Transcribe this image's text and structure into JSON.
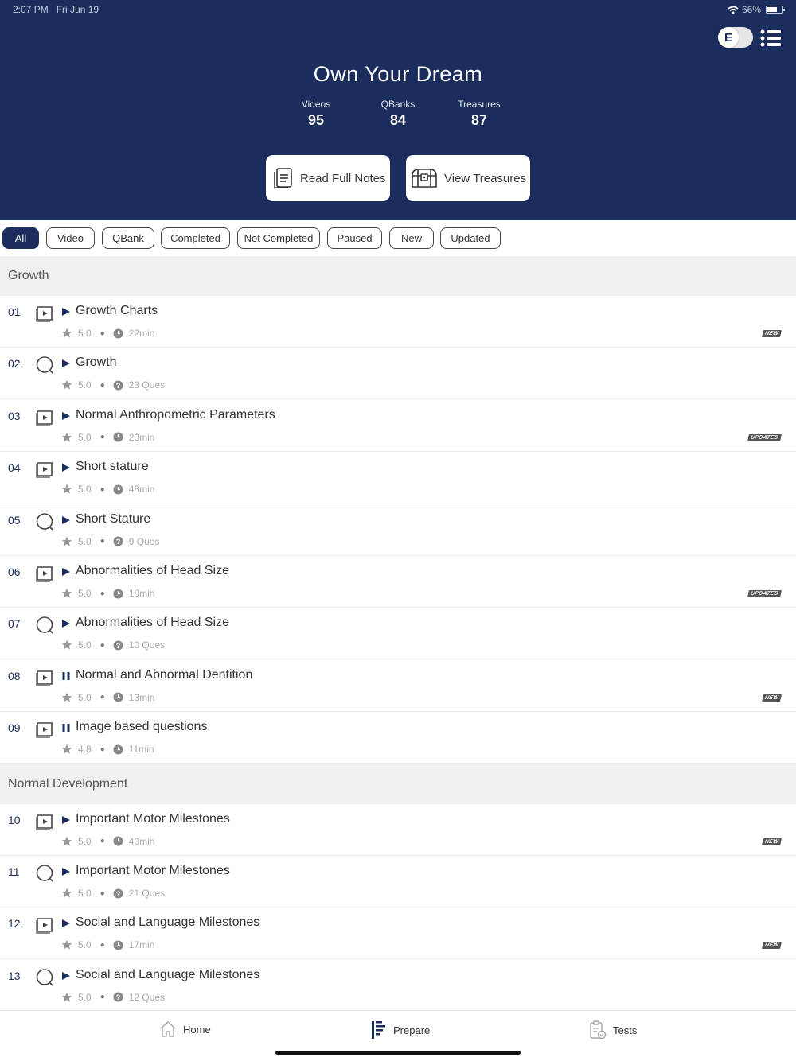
{
  "status_bar": {
    "time": "2:07 PM",
    "date": "Fri Jun 19",
    "battery": "66%"
  },
  "header": {
    "toggle_letter": "E",
    "title": "Own Your Dream",
    "stats": [
      {
        "label": "Videos",
        "value": "95"
      },
      {
        "label": "QBanks",
        "value": "84"
      },
      {
        "label": "Treasures",
        "value": "87"
      }
    ],
    "read_notes_label": "Read Full Notes",
    "view_treasures_label": "View Treasures"
  },
  "filters": [
    "All",
    "Video",
    "QBank",
    "Completed",
    "Not Completed",
    "Paused",
    "New",
    "Updated"
  ],
  "active_filter": "All",
  "sections": [
    {
      "title": "Growth",
      "items": [
        {
          "num": "01",
          "type": "video",
          "state": "play",
          "title": "Growth Charts",
          "rating": "5.0",
          "info": "22min",
          "badge": "NEW"
        },
        {
          "num": "02",
          "type": "qbank",
          "state": "play",
          "title": "Growth",
          "rating": "5.0",
          "info": "23 Ques",
          "badge": ""
        },
        {
          "num": "03",
          "type": "video",
          "state": "play",
          "title": "Normal Anthropometric Parameters",
          "rating": "5.0",
          "info": "23min",
          "badge": "UPDATED"
        },
        {
          "num": "04",
          "type": "video",
          "state": "play",
          "title": "Short stature",
          "rating": "5.0",
          "info": "48min",
          "badge": ""
        },
        {
          "num": "05",
          "type": "qbank",
          "state": "play",
          "title": "Short Stature",
          "rating": "5.0",
          "info": "9 Ques",
          "badge": ""
        },
        {
          "num": "06",
          "type": "video",
          "state": "play",
          "title": "Abnormalities of Head Size",
          "rating": "5.0",
          "info": "18min",
          "badge": "UPDATED"
        },
        {
          "num": "07",
          "type": "qbank",
          "state": "play",
          "title": "Abnormalities of Head Size",
          "rating": "5.0",
          "info": "10 Ques",
          "badge": ""
        },
        {
          "num": "08",
          "type": "video",
          "state": "pause",
          "title": "Normal and Abnormal Dentition",
          "rating": "5.0",
          "info": "13min",
          "badge": "NEW"
        },
        {
          "num": "09",
          "type": "video",
          "state": "pause",
          "title": "Image based questions",
          "rating": "4.8",
          "info": "11min",
          "badge": ""
        }
      ]
    },
    {
      "title": "Normal Development",
      "items": [
        {
          "num": "10",
          "type": "video",
          "state": "play",
          "title": "Important Motor Milestones",
          "rating": "5.0",
          "info": "40min",
          "badge": "NEW"
        },
        {
          "num": "11",
          "type": "qbank",
          "state": "play",
          "title": "Important Motor Milestones",
          "rating": "5.0",
          "info": "21 Ques",
          "badge": ""
        },
        {
          "num": "12",
          "type": "video",
          "state": "play",
          "title": "Social and Language Milestones",
          "rating": "5.0",
          "info": "17min",
          "badge": "NEW"
        },
        {
          "num": "13",
          "type": "qbank",
          "state": "play",
          "title": "Social and Language Milestones",
          "rating": "5.0",
          "info": "12 Ques",
          "badge": ""
        }
      ]
    }
  ],
  "bottom_nav": [
    {
      "label": "Home",
      "icon": "home-icon"
    },
    {
      "label": "Prepare",
      "icon": "prepare-icon"
    },
    {
      "label": "Tests",
      "icon": "tests-icon"
    }
  ],
  "colors": {
    "header_bg": "#1b2d5c",
    "accent": "#1b2d5c",
    "badge_bg": "#555555"
  }
}
